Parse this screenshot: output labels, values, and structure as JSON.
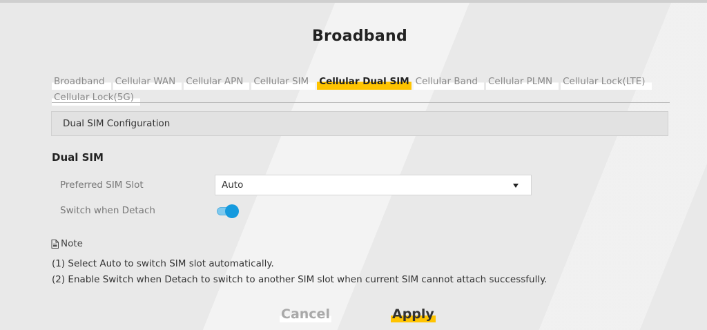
{
  "page": {
    "title": "Broadband"
  },
  "tabs": [
    {
      "label": "Broadband"
    },
    {
      "label": "Cellular WAN"
    },
    {
      "label": "Cellular APN"
    },
    {
      "label": "Cellular SIM"
    },
    {
      "label": "Cellular Dual SIM",
      "active": true
    },
    {
      "label": "Cellular Band"
    },
    {
      "label": "Cellular PLMN"
    },
    {
      "label": "Cellular Lock(LTE)"
    },
    {
      "label": "Cellular Lock(5G)"
    }
  ],
  "section": {
    "title": "Dual SIM Configuration"
  },
  "dual_sim": {
    "heading": "Dual SIM",
    "preferred_slot_label": "Preferred SIM Slot",
    "preferred_slot_value": "Auto",
    "switch_detach_label": "Switch when Detach",
    "switch_detach_on": true
  },
  "note": {
    "title": "Note",
    "lines": [
      "(1) Select Auto to switch SIM slot automatically.",
      "(2) Enable Switch when Detach to switch to another SIM slot when current SIM cannot attach successfully."
    ]
  },
  "buttons": {
    "cancel": "Cancel",
    "apply": "Apply"
  },
  "colors": {
    "accent": "#ffc400",
    "toggle_on": "#159ade"
  },
  "icons": {
    "note": "note-document-icon",
    "dropdown": "caret-down-icon"
  }
}
